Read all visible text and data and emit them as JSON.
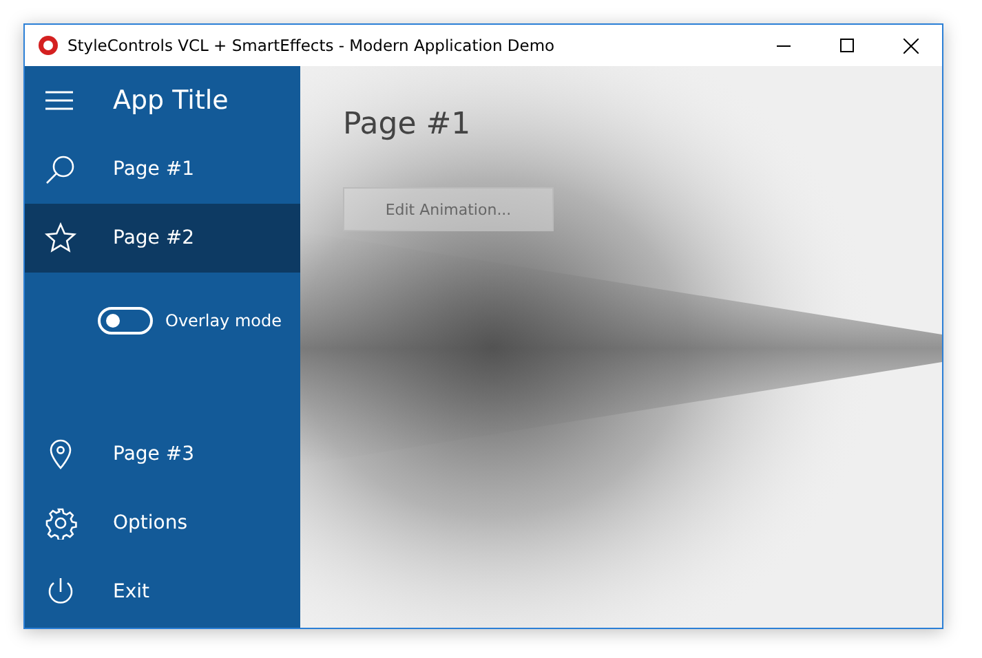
{
  "window": {
    "title": "StyleControls VCL + SmartEffects - Modern Application Demo"
  },
  "sidebar": {
    "app_title": "App Title",
    "items": [
      {
        "label": "Page #1",
        "kind": "search",
        "selected": false
      },
      {
        "label": "Page #2",
        "kind": "star",
        "selected": true
      }
    ],
    "overlay_toggle": {
      "label": "Overlay mode",
      "on": false
    },
    "bottom_items": [
      {
        "label": "Page #3",
        "kind": "pin",
        "selected": false
      },
      {
        "label": "Options",
        "kind": "gear",
        "selected": false
      },
      {
        "label": "Exit",
        "kind": "power",
        "selected": false
      }
    ]
  },
  "content": {
    "heading": "Page #1",
    "button": {
      "label": "Edit Animation...",
      "disabled": true
    }
  }
}
